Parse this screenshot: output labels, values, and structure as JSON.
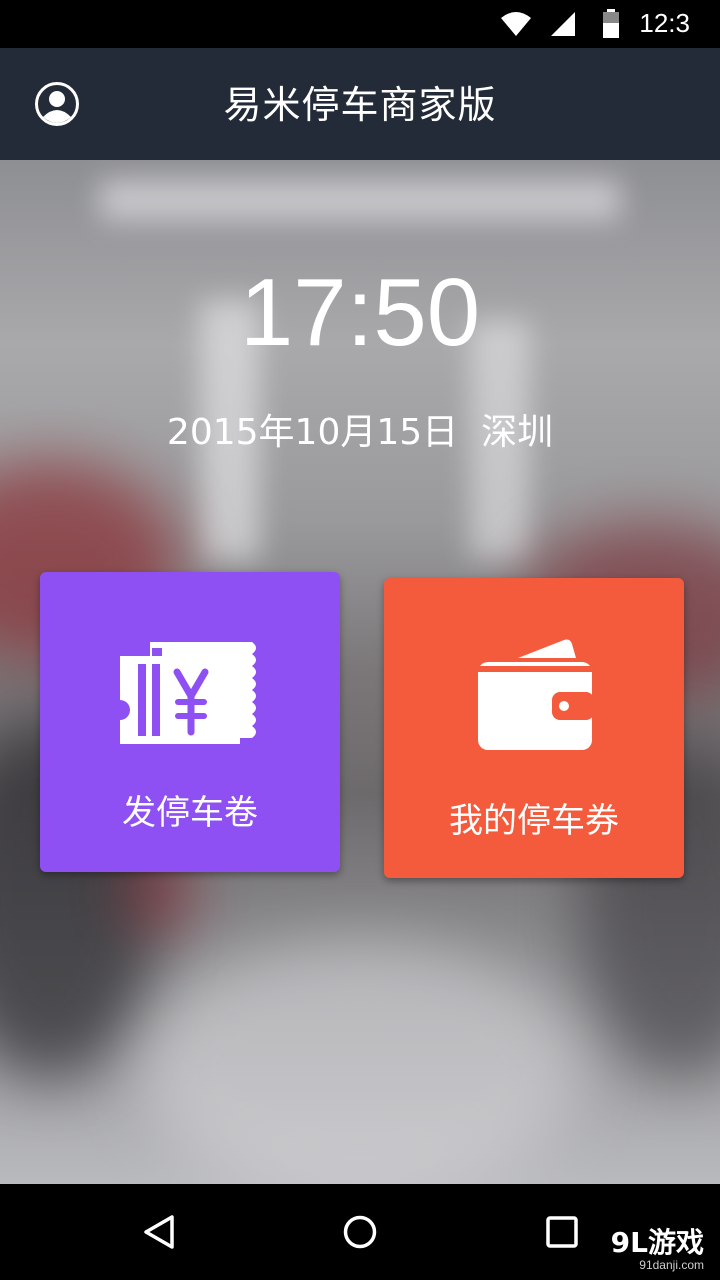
{
  "status_bar": {
    "time": "12:3",
    "icons": [
      "wifi-icon",
      "signal-icon",
      "battery-icon"
    ]
  },
  "app_bar": {
    "title": "易米停车商家版",
    "profile_icon": "user-profile-icon"
  },
  "main": {
    "clock": "17:50",
    "date": "2015年10月15日",
    "city": "深圳",
    "tiles": [
      {
        "label": "发停车卷",
        "icon": "ticket-yuan-icon",
        "color": "#8e50f3"
      },
      {
        "label": "我的停车券",
        "icon": "wallet-icon",
        "color": "#f35b3c"
      }
    ]
  },
  "nav_bar": {
    "buttons": [
      "back-icon",
      "home-icon",
      "recents-icon"
    ]
  },
  "watermark": {
    "logo": "9L游戏",
    "domain": "91danji.com"
  }
}
